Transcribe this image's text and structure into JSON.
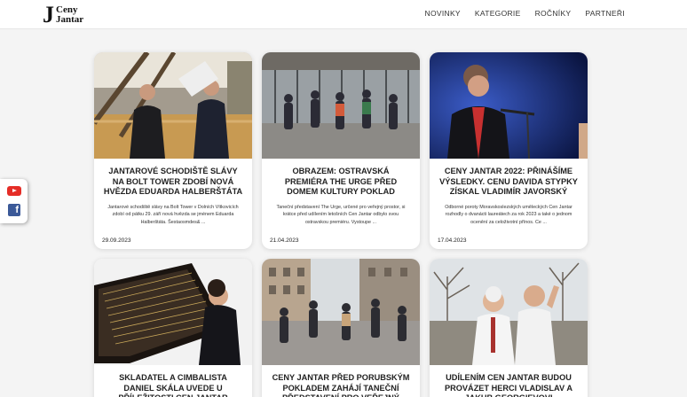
{
  "logo": {
    "j": "J",
    "line1": "Ceny",
    "line2": "Jantar"
  },
  "nav": [
    {
      "label": "NOVINKY"
    },
    {
      "label": "KATEGORIE"
    },
    {
      "label": "ROČNÍKY"
    },
    {
      "label": "PARTNEŘI"
    }
  ],
  "social": {
    "youtube_icon": "youtube-icon",
    "facebook_icon": "facebook-icon",
    "facebook_glyph": "f"
  },
  "cards": [
    {
      "title": "JANTAROVÉ SCHODIŠTĚ SLÁVY NA BOLT TOWER ZDOBÍ NOVÁ HVĚZDA EDUARDA HALBERŠTÁTA",
      "excerpt": "Jantarové schodiště slávy na Bolt Tower v Dolních Vítkovicích zdobí od pátku 29. září nová hvězda se jménem Eduarda Halberštáta. Šestaosmdes& ...",
      "date": "29.09.2023"
    },
    {
      "title": "OBRAZEM: OSTRAVSKÁ PREMIÉRA THE URGE PŘED DOMEM KULTURY POKLAD",
      "excerpt": "Taneční představení The Urge, určené pro veřejný prostor, si krátce před udílením letošních Cen Jantar odbylo svou ostravskou premiéru. Vystoupe ...",
      "date": "21.04.2023"
    },
    {
      "title": "CENY JANTAR 2022: PŘINÁŠÍME VÝSLEDKY. CENU DAVIDA STYPKY ZÍSKAL VLADIMÍR JAVORSKÝ",
      "excerpt": "Odborné poroty Moravskoslezských uměleckých Cen Jantar rozhodly o dvanácti laureátech za rok 2023 a také o jednom ocenění za celoživotní přínos. Ce ...",
      "date": "17.04.2023"
    },
    {
      "title": "SKLADATEL A CIMBALISTA DANIEL SKÁLA UVEDE U PŘÍLEŽITOSTI CEN JANTAR NOVOU SKLADBU",
      "excerpt": "",
      "date": ""
    },
    {
      "title": "CENY JANTAR PŘED PORUBSKÝM POKLADEM ZAHÁJÍ TANEČNÍ PŘEDSTAVENÍ PRO VEŘEJNÝ PROSTOR",
      "excerpt": "",
      "date": ""
    },
    {
      "title": "UDÍLENÍM CEN JANTAR BUDOU PROVÁZET HERCI VLADISLAV A JAKUB GEORGIEVOVI",
      "excerpt": "",
      "date": ""
    }
  ],
  "colors": {
    "youtube": "#e52d27",
    "facebook": "#3b5998",
    "background": "#f4f4f4"
  }
}
